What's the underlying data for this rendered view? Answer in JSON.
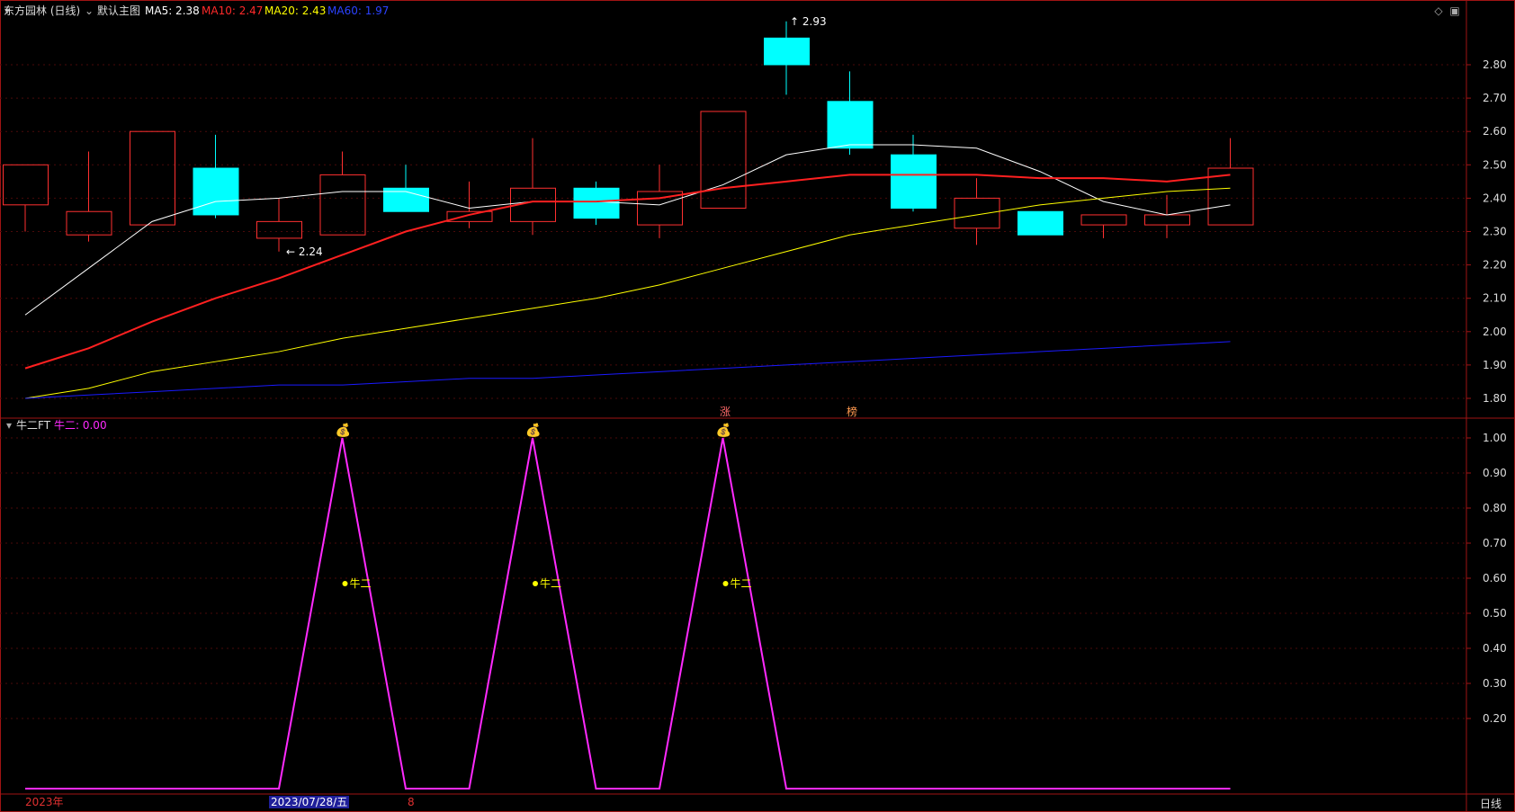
{
  "header": {
    "stock_name": "东方园林 (日线)",
    "template_label": "默认主图",
    "ma5": "MA5: 2.38",
    "ma10": "MA10: 2.47",
    "ma20": "MA20: 2.43",
    "ma60": "MA60: 1.97",
    "colors": {
      "ma5": "#ffffff",
      "ma10": "#ff2a2a",
      "ma20": "#ffff00",
      "ma60": "#1a33ff"
    }
  },
  "indicator_header": {
    "name": "牛二FT",
    "value": "牛二: 0.00"
  },
  "icons": {
    "collapse": "chevron-down-icon",
    "diamond": "diamond-icon",
    "window": "window-icon",
    "peak": "money-bag-icon"
  },
  "footer": {
    "year": "2023年",
    "selected_date": "2023/07/28/五",
    "month_mark": "8",
    "period_tab": "日线"
  },
  "markers": {
    "zhang": "涨",
    "bang": "榜"
  },
  "annotations": {
    "high": "2.93",
    "low": "2.24",
    "signal": "牛二"
  },
  "chart_data": [
    {
      "type": "candlestick",
      "title": "东方园林 (日线)",
      "ylim": [
        1.78,
        2.93
      ],
      "yticks": [
        "2.80",
        "2.70",
        "2.60",
        "2.50",
        "2.40",
        "2.30",
        "2.20",
        "2.10",
        "2.00",
        "1.90",
        "1.80"
      ],
      "candles": [
        {
          "o": 2.38,
          "h": 2.5,
          "l": 2.3,
          "c": 2.5
        },
        {
          "o": 2.29,
          "h": 2.54,
          "l": 2.27,
          "c": 2.36
        },
        {
          "o": 2.32,
          "h": 2.6,
          "l": 2.32,
          "c": 2.6
        },
        {
          "o": 2.49,
          "h": 2.59,
          "l": 2.34,
          "c": 2.35
        },
        {
          "o": 2.28,
          "h": 2.4,
          "l": 2.24,
          "c": 2.33
        },
        {
          "o": 2.29,
          "h": 2.54,
          "l": 2.29,
          "c": 2.47
        },
        {
          "o": 2.43,
          "h": 2.5,
          "l": 2.36,
          "c": 2.36
        },
        {
          "o": 2.33,
          "h": 2.45,
          "l": 2.31,
          "c": 2.36
        },
        {
          "o": 2.33,
          "h": 2.58,
          "l": 2.29,
          "c": 2.43
        },
        {
          "o": 2.43,
          "h": 2.45,
          "l": 2.32,
          "c": 2.34
        },
        {
          "o": 2.32,
          "h": 2.5,
          "l": 2.28,
          "c": 2.42
        },
        {
          "o": 2.37,
          "h": 2.66,
          "l": 2.37,
          "c": 2.66
        },
        {
          "o": 2.88,
          "h": 2.93,
          "l": 2.71,
          "c": 2.8
        },
        {
          "o": 2.69,
          "h": 2.78,
          "l": 2.53,
          "c": 2.55
        },
        {
          "o": 2.53,
          "h": 2.59,
          "l": 2.36,
          "c": 2.37
        },
        {
          "o": 2.31,
          "h": 2.46,
          "l": 2.26,
          "c": 2.4
        },
        {
          "o": 2.36,
          "h": 2.36,
          "l": 2.29,
          "c": 2.29
        },
        {
          "o": 2.32,
          "h": 2.35,
          "l": 2.28,
          "c": 2.35
        },
        {
          "o": 2.32,
          "h": 2.41,
          "l": 2.28,
          "c": 2.35
        },
        {
          "o": 2.32,
          "h": 2.58,
          "l": 2.32,
          "c": 2.49
        }
      ],
      "series": [
        {
          "name": "MA5",
          "values": [
            2.05,
            2.19,
            2.33,
            2.39,
            2.4,
            2.42,
            2.42,
            2.37,
            2.39,
            2.39,
            2.38,
            2.44,
            2.53,
            2.56,
            2.56,
            2.55,
            2.48,
            2.39,
            2.35,
            2.38
          ]
        },
        {
          "name": "MA10",
          "values": [
            1.89,
            1.95,
            2.03,
            2.1,
            2.16,
            2.23,
            2.3,
            2.35,
            2.39,
            2.39,
            2.4,
            2.43,
            2.45,
            2.47,
            2.47,
            2.47,
            2.46,
            2.46,
            2.45,
            2.47
          ]
        },
        {
          "name": "MA20",
          "values": [
            1.8,
            1.83,
            1.88,
            1.91,
            1.94,
            1.98,
            2.01,
            2.04,
            2.07,
            2.1,
            2.14,
            2.19,
            2.24,
            2.29,
            2.32,
            2.35,
            2.38,
            2.4,
            2.42,
            2.43
          ]
        },
        {
          "name": "MA60",
          "values": [
            1.8,
            1.81,
            1.82,
            1.83,
            1.84,
            1.84,
            1.85,
            1.86,
            1.86,
            1.87,
            1.88,
            1.89,
            1.9,
            1.91,
            1.92,
            1.93,
            1.94,
            1.95,
            1.96,
            1.97
          ]
        }
      ]
    },
    {
      "type": "line",
      "title": "牛二FT",
      "ylim": [
        0,
        1.0
      ],
      "yticks": [
        "1.00",
        "0.90",
        "0.80",
        "0.70",
        "0.60",
        "0.50",
        "0.40",
        "0.30",
        "0.20"
      ],
      "series": [
        {
          "name": "牛二",
          "values": [
            0,
            0,
            0,
            0,
            0,
            1,
            0,
            0,
            1,
            0,
            0,
            1,
            0,
            0,
            0,
            0,
            0,
            0,
            0,
            0
          ]
        }
      ]
    }
  ]
}
